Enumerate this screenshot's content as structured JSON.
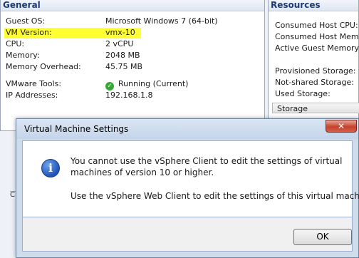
{
  "general": {
    "header": "General",
    "rows": [
      {
        "label": "Guest OS:",
        "value": "Microsoft Windows 7 (64-bit)"
      },
      {
        "label": "VM Version:",
        "value": "vmx-10"
      },
      {
        "label": "CPU:",
        "value": "2 vCPU"
      },
      {
        "label": "Memory:",
        "value": "2048 MB"
      },
      {
        "label": "Memory Overhead:",
        "value": "45.75 MB"
      },
      {
        "label": "VMware Tools:",
        "value": "Running (Current)"
      },
      {
        "label": "IP Addresses:",
        "value": "192.168.1.8"
      }
    ],
    "highlight_color": "#ffff33",
    "tools_status_icon": "green-check-icon"
  },
  "resources": {
    "header": "Resources",
    "rows": [
      "Consumed Host CPU:",
      "Consumed Host Memory:",
      "Active Guest Memory:",
      "Provisioned Storage:",
      "Not-shared Storage:",
      "Used Storage:"
    ],
    "storage_column": "Storage"
  },
  "dialog": {
    "title": "Virtual Machine Settings",
    "close_label": "✕",
    "icon": "info-icon",
    "message_line1": "You cannot use the vSphere Client to edit the settings of virtual",
    "message_line2": "machines of version 10 or higher.",
    "message_line3": "Use the vSphere Web Client to edit the settings of this virtual machine.",
    "ok_label": "OK"
  }
}
